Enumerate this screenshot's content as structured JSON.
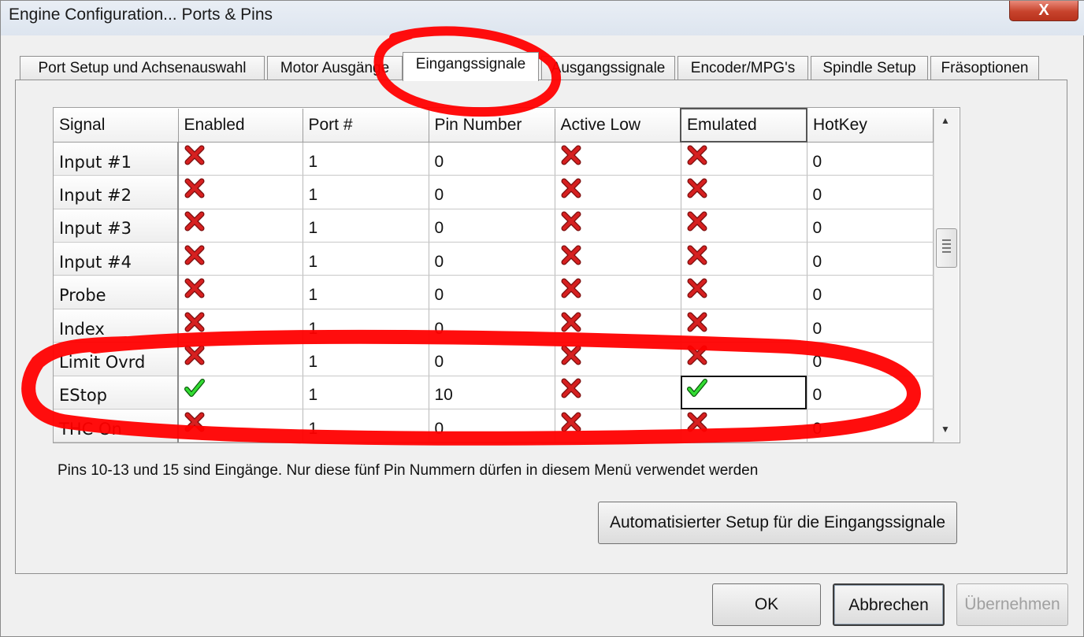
{
  "window": {
    "title": "Engine Configuration... Ports & Pins",
    "close_label": "X"
  },
  "tabs": [
    {
      "label": "Port Setup und Achsenauswahl",
      "active": false
    },
    {
      "label": "Motor Ausgänge",
      "active": false
    },
    {
      "label": "Eingangssignale",
      "active": true
    },
    {
      "label": "Ausgangssignale",
      "active": false
    },
    {
      "label": "Encoder/MPG's",
      "active": false
    },
    {
      "label": "Spindle Setup",
      "active": false
    },
    {
      "label": "Fräsoptionen",
      "active": false
    }
  ],
  "table": {
    "columns": [
      "Signal",
      "Enabled",
      "Port #",
      "Pin Number",
      "Active Low",
      "Emulated",
      "HotKey"
    ],
    "rows": [
      {
        "signal": "Input #1",
        "enabled": false,
        "port": "1",
        "pin": "0",
        "active_low": false,
        "emulated": false,
        "hotkey": "0"
      },
      {
        "signal": "Input #2",
        "enabled": false,
        "port": "1",
        "pin": "0",
        "active_low": false,
        "emulated": false,
        "hotkey": "0"
      },
      {
        "signal": "Input #3",
        "enabled": false,
        "port": "1",
        "pin": "0",
        "active_low": false,
        "emulated": false,
        "hotkey": "0"
      },
      {
        "signal": "Input #4",
        "enabled": false,
        "port": "1",
        "pin": "0",
        "active_low": false,
        "emulated": false,
        "hotkey": "0"
      },
      {
        "signal": "Probe",
        "enabled": false,
        "port": "1",
        "pin": "0",
        "active_low": false,
        "emulated": false,
        "hotkey": "0"
      },
      {
        "signal": "Index",
        "enabled": false,
        "port": "1",
        "pin": "0",
        "active_low": false,
        "emulated": false,
        "hotkey": "0"
      },
      {
        "signal": "Limit Ovrd",
        "enabled": false,
        "port": "1",
        "pin": "0",
        "active_low": false,
        "emulated": false,
        "hotkey": "0"
      },
      {
        "signal": "EStop",
        "enabled": true,
        "port": "1",
        "pin": "10",
        "active_low": false,
        "emulated": true,
        "hotkey": "0"
      },
      {
        "signal": "THC On",
        "enabled": false,
        "port": "1",
        "pin": "0",
        "active_low": false,
        "emulated": false,
        "hotkey": "0"
      }
    ]
  },
  "hint_text": "Pins 10-13 und 15 sind Eingänge. Nur diese fünf Pin Nummern dürfen in diesem Menü verwendet werden",
  "buttons": {
    "auto_setup": "Automatisierter Setup für die Eingangssignale",
    "ok": "OK",
    "cancel": "Abbrechen",
    "apply": "Übernehmen"
  },
  "icons": {
    "false_icon": "red-x-icon",
    "true_icon": "green-check-icon"
  },
  "colors": {
    "annotation": "#ff0000",
    "x_icon": "#d62020",
    "check_icon": "#22cc22"
  }
}
